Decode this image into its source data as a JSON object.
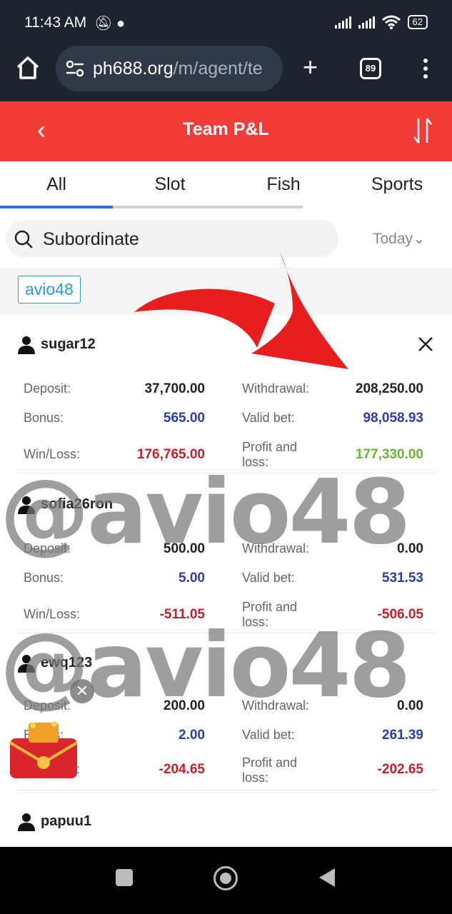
{
  "status_bar": {
    "time": "11:43 AM",
    "battery": "62"
  },
  "browser": {
    "url_host": "ph688.org",
    "url_path": "/m/agent/te",
    "tab_count": "89"
  },
  "header": {
    "title": "Team P&L"
  },
  "tabs": [
    {
      "label": "All"
    },
    {
      "label": "Slot"
    },
    {
      "label": "Fish"
    },
    {
      "label": "Sports"
    }
  ],
  "search": {
    "label": "Subordinate"
  },
  "date_filter": {
    "label": "Today"
  },
  "breadcrumb": {
    "tag": "avio48"
  },
  "labels": {
    "deposit": "Deposit:",
    "withdrawal": "Withdrawal:",
    "bonus": "Bonus:",
    "valid_bet": "Valid bet:",
    "win_loss": "Win/Loss:",
    "profit_loss_1": "Profit and",
    "profit_loss_2": "loss:"
  },
  "members": [
    {
      "name": "sugar12",
      "deposit": "37,700.00",
      "withdrawal": "208,250.00",
      "bonus": "565.00",
      "valid_bet": "98,058.93",
      "win_loss": "176,765.00",
      "profit_loss": "177,330.00"
    },
    {
      "name": "sofia26ron",
      "deposit": "500.00",
      "withdrawal": "0.00",
      "bonus": "5.00",
      "valid_bet": "531.53",
      "win_loss": "-511.05",
      "profit_loss": "-506.05"
    },
    {
      "name": "ewq123",
      "deposit": "200.00",
      "withdrawal": "0.00",
      "bonus": "2.00",
      "valid_bet": "261.39",
      "win_loss": "-204.65",
      "profit_loss": "-202.65"
    },
    {
      "name": "papuu1"
    }
  ],
  "watermark": "@avio48",
  "colors": {
    "header": "#f23c37",
    "blue_value": "#2b3eb0",
    "red_value": "#c6202a",
    "green_value": "#68b82e",
    "active_tab": "#2f6fd6"
  }
}
